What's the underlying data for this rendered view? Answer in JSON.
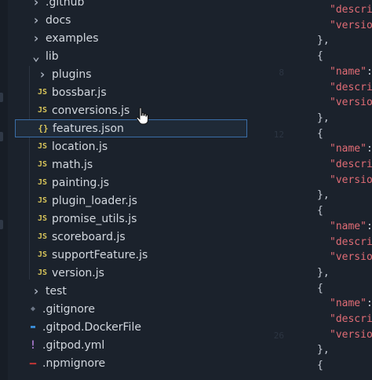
{
  "explorer": {
    "items": [
      {
        "label": ".github",
        "icon": "chevron-right-icon",
        "name": "folder-github"
      },
      {
        "label": "docs",
        "icon": "chevron-right-icon",
        "name": "folder-docs"
      },
      {
        "label": "examples",
        "icon": "chevron-right-icon",
        "name": "folder-examples"
      },
      {
        "label": "lib",
        "icon": "chevron-down-icon",
        "name": "folder-lib"
      },
      {
        "label": "plugins",
        "icon": "chevron-right-icon",
        "name": "folder-plugins"
      },
      {
        "label": "bossbar.js",
        "icon": "js-file-icon",
        "name": "file-bossbar-js"
      },
      {
        "label": "conversions.js",
        "icon": "js-file-icon",
        "name": "file-conversions-js"
      },
      {
        "label": "features.json",
        "icon": "json-file-icon",
        "name": "file-features-json"
      },
      {
        "label": "location.js",
        "icon": "js-file-icon",
        "name": "file-location-js"
      },
      {
        "label": "math.js",
        "icon": "js-file-icon",
        "name": "file-math-js"
      },
      {
        "label": "painting.js",
        "icon": "js-file-icon",
        "name": "file-painting-js"
      },
      {
        "label": "plugin_loader.js",
        "icon": "js-file-icon",
        "name": "file-plugin-loader-js"
      },
      {
        "label": "promise_utils.js",
        "icon": "js-file-icon",
        "name": "file-promise-utils-js"
      },
      {
        "label": "scoreboard.js",
        "icon": "js-file-icon",
        "name": "file-scoreboard-js"
      },
      {
        "label": "supportFeature.js",
        "icon": "js-file-icon",
        "name": "file-supportfeature-js"
      },
      {
        "label": "version.js",
        "icon": "js-file-icon",
        "name": "file-version-js"
      },
      {
        "label": "test",
        "icon": "chevron-right-icon",
        "name": "folder-test"
      },
      {
        "label": ".gitignore",
        "icon": "git-icon",
        "name": "file-gitignore"
      },
      {
        "label": ".gitpod.DockerFile",
        "icon": "docker-icon",
        "name": "file-gitpod-dockerfile"
      },
      {
        "label": ".gitpod.yml",
        "icon": "yml-icon",
        "name": "file-gitpod-yml"
      },
      {
        "label": ".npmignore",
        "icon": "npm-icon",
        "name": "file-npmignore"
      }
    ],
    "selected_index": 7
  },
  "editor": {
    "line_numbers": [
      "",
      "",
      "",
      "",
      "8",
      "",
      "",
      "",
      "12",
      "",
      "",
      "",
      "",
      "",
      "",
      "",
      "",
      "",
      "",
      "",
      "",
      "26"
    ],
    "lines": [
      {
        "tokens": [
          {
            "t": "\"descri",
            "c": "key"
          }
        ]
      },
      {
        "tokens": [
          {
            "t": "\"versio",
            "c": "key"
          }
        ]
      },
      {
        "tokens": [
          {
            "t": "},",
            "c": "punc"
          }
        ]
      },
      {
        "tokens": [
          {
            "t": "{",
            "c": "punc"
          }
        ]
      },
      {
        "tokens": [
          {
            "t": "\"name\"",
            "c": "key"
          },
          {
            "t": ":",
            "c": "punc"
          }
        ]
      },
      {
        "tokens": [
          {
            "t": "\"descri",
            "c": "key"
          }
        ]
      },
      {
        "tokens": [
          {
            "t": "\"versio",
            "c": "key"
          }
        ]
      },
      {
        "tokens": [
          {
            "t": "},",
            "c": "punc"
          }
        ]
      },
      {
        "tokens": [
          {
            "t": "{",
            "c": "punc"
          }
        ]
      },
      {
        "tokens": [
          {
            "t": "\"name\"",
            "c": "key"
          },
          {
            "t": ":",
            "c": "punc"
          }
        ]
      },
      {
        "tokens": [
          {
            "t": "\"descri",
            "c": "key"
          }
        ]
      },
      {
        "tokens": [
          {
            "t": "\"versio",
            "c": "key"
          }
        ]
      },
      {
        "tokens": [
          {
            "t": "},",
            "c": "punc"
          }
        ]
      },
      {
        "tokens": [
          {
            "t": "{",
            "c": "punc"
          }
        ]
      },
      {
        "tokens": [
          {
            "t": "\"name\"",
            "c": "key"
          },
          {
            "t": ":",
            "c": "punc"
          }
        ]
      },
      {
        "tokens": [
          {
            "t": "\"descri",
            "c": "key"
          }
        ]
      },
      {
        "tokens": [
          {
            "t": "\"versio",
            "c": "key"
          }
        ]
      },
      {
        "tokens": [
          {
            "t": "},",
            "c": "punc"
          }
        ]
      },
      {
        "tokens": [
          {
            "t": "{",
            "c": "punc"
          }
        ]
      },
      {
        "tokens": [
          {
            "t": "\"name\"",
            "c": "key"
          },
          {
            "t": ":",
            "c": "punc"
          }
        ]
      },
      {
        "tokens": [
          {
            "t": "\"descri",
            "c": "key"
          }
        ]
      },
      {
        "tokens": [
          {
            "t": "\"versio",
            "c": "key"
          }
        ]
      },
      {
        "tokens": [
          {
            "t": "},",
            "c": "punc"
          }
        ]
      },
      {
        "tokens": [
          {
            "t": "{",
            "c": "punc"
          }
        ]
      }
    ]
  },
  "colors": {
    "background": "#1b222c",
    "selection_border": "#3a6ea8",
    "js_icon": "#d7c45a",
    "json_key": "#e06c75",
    "text": "#d2d7de"
  }
}
